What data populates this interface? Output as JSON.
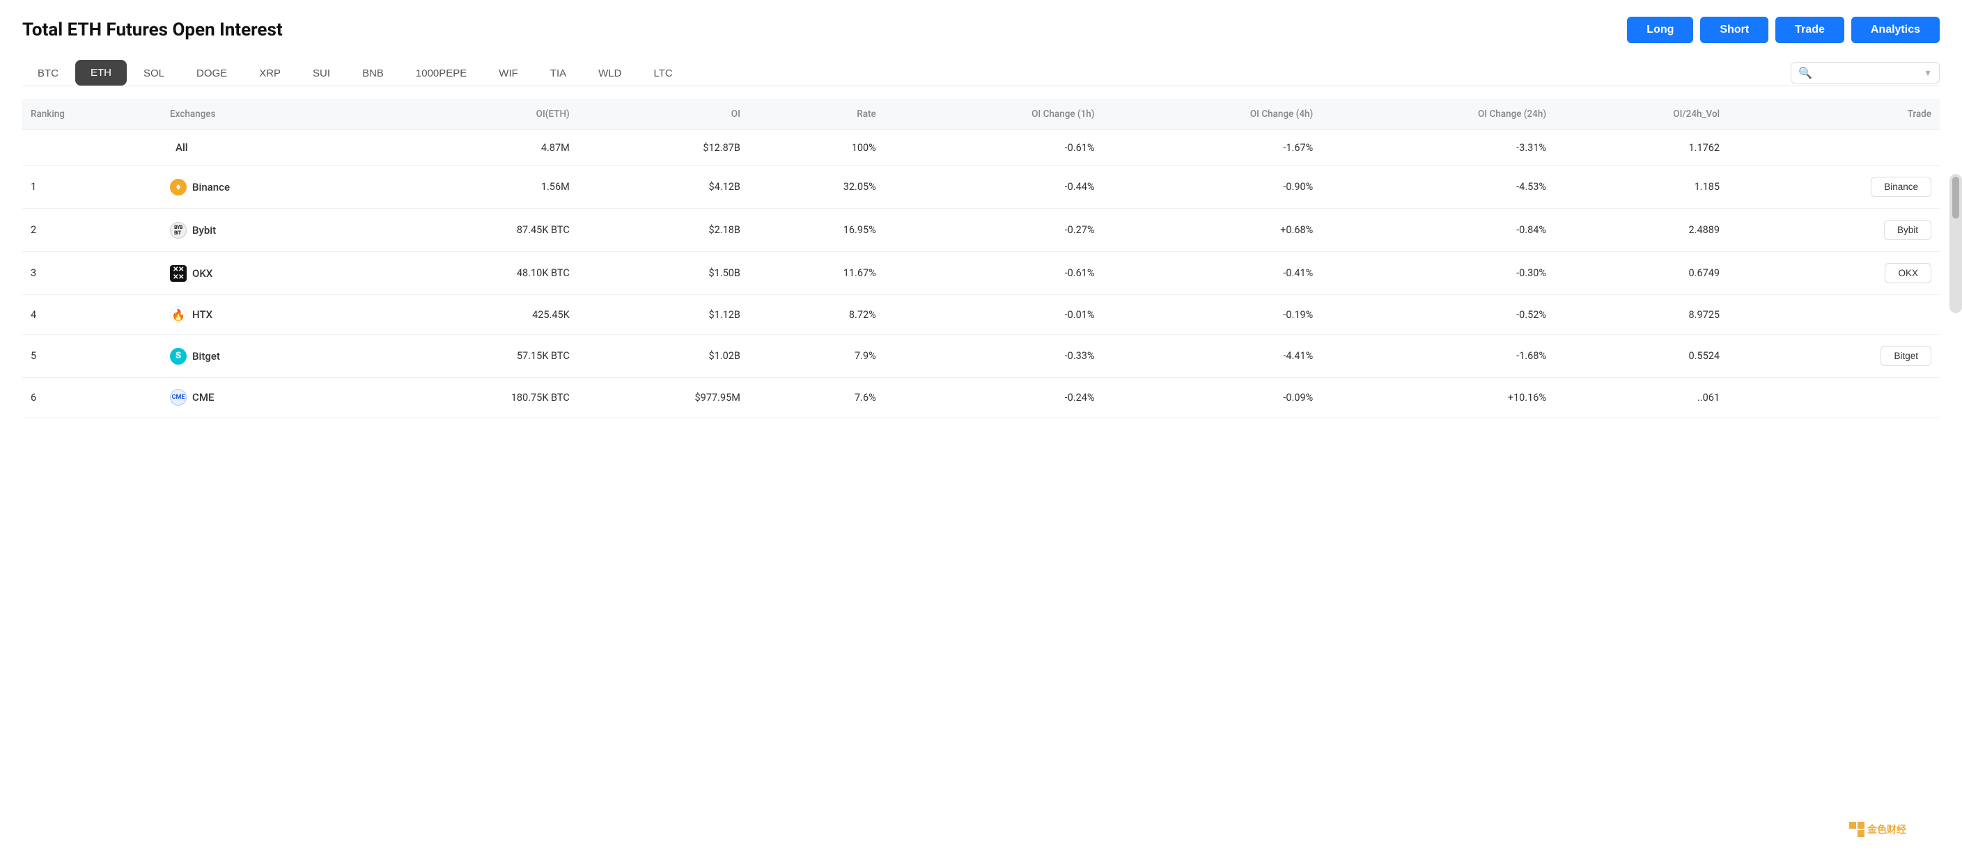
{
  "page": {
    "title": "Total ETH Futures Open Interest"
  },
  "header_buttons": [
    {
      "label": "Long",
      "key": "long"
    },
    {
      "label": "Short",
      "key": "short"
    },
    {
      "label": "Trade",
      "key": "trade"
    },
    {
      "label": "Analytics",
      "key": "analytics"
    }
  ],
  "asset_tabs": [
    {
      "label": "BTC",
      "active": false
    },
    {
      "label": "ETH",
      "active": true
    },
    {
      "label": "SOL",
      "active": false
    },
    {
      "label": "DOGE",
      "active": false
    },
    {
      "label": "XRP",
      "active": false
    },
    {
      "label": "SUI",
      "active": false
    },
    {
      "label": "BNB",
      "active": false
    },
    {
      "label": "1000PEPE",
      "active": false
    },
    {
      "label": "WIF",
      "active": false
    },
    {
      "label": "TIA",
      "active": false
    },
    {
      "label": "WLD",
      "active": false
    },
    {
      "label": "LTC",
      "active": false
    }
  ],
  "search": {
    "placeholder": ""
  },
  "table": {
    "columns": [
      "Ranking",
      "Exchanges",
      "OI(ETH)",
      "OI",
      "Rate",
      "OI Change (1h)",
      "OI Change (4h)",
      "OI Change (24h)",
      "OI/24h_Vol",
      "Trade"
    ],
    "rows": [
      {
        "ranking": "",
        "exchange": "All",
        "exchange_icon": "all",
        "oi_eth": "4.87M",
        "oi": "$12.87B",
        "rate": "100%",
        "oi_1h": "-0.61%",
        "oi_1h_color": "red",
        "oi_4h": "-1.67%",
        "oi_4h_color": "red",
        "oi_24h": "-3.31%",
        "oi_24h_color": "red",
        "oi_vol": "1.1762",
        "trade_btn": ""
      },
      {
        "ranking": "1",
        "exchange": "Binance",
        "exchange_icon": "binance",
        "oi_eth": "1.56M",
        "oi": "$4.12B",
        "rate": "32.05%",
        "oi_1h": "-0.44%",
        "oi_1h_color": "red",
        "oi_4h": "-0.90%",
        "oi_4h_color": "red",
        "oi_24h": "-4.53%",
        "oi_24h_color": "red",
        "oi_vol": "1.185",
        "trade_btn": "Binance"
      },
      {
        "ranking": "2",
        "exchange": "Bybit",
        "exchange_icon": "bybit",
        "oi_eth": "87.45K BTC",
        "oi": "$2.18B",
        "rate": "16.95%",
        "oi_1h": "-0.27%",
        "oi_1h_color": "red",
        "oi_4h": "+0.68%",
        "oi_4h_color": "green",
        "oi_24h": "-0.84%",
        "oi_24h_color": "red",
        "oi_vol": "2.4889",
        "trade_btn": "Bybit"
      },
      {
        "ranking": "3",
        "exchange": "OKX",
        "exchange_icon": "okx",
        "oi_eth": "48.10K BTC",
        "oi": "$1.50B",
        "rate": "11.67%",
        "oi_1h": "-0.61%",
        "oi_1h_color": "red",
        "oi_4h": "-0.41%",
        "oi_4h_color": "red",
        "oi_24h": "-0.30%",
        "oi_24h_color": "red",
        "oi_vol": "0.6749",
        "trade_btn": "OKX"
      },
      {
        "ranking": "4",
        "exchange": "HTX",
        "exchange_icon": "htx",
        "oi_eth": "425.45K",
        "oi": "$1.12B",
        "rate": "8.72%",
        "oi_1h": "-0.01%",
        "oi_1h_color": "red",
        "oi_4h": "-0.19%",
        "oi_4h_color": "red",
        "oi_24h": "-0.52%",
        "oi_24h_color": "red",
        "oi_vol": "8.9725",
        "trade_btn": ""
      },
      {
        "ranking": "5",
        "exchange": "Bitget",
        "exchange_icon": "bitget",
        "oi_eth": "57.15K BTC",
        "oi": "$1.02B",
        "rate": "7.9%",
        "oi_1h": "-0.33%",
        "oi_1h_color": "red",
        "oi_4h": "-4.41%",
        "oi_4h_color": "red",
        "oi_24h": "-1.68%",
        "oi_24h_color": "red",
        "oi_vol": "0.5524",
        "trade_btn": "Bitget"
      },
      {
        "ranking": "6",
        "exchange": "CME",
        "exchange_icon": "cme",
        "oi_eth": "180.75K BTC",
        "oi": "$977.95M",
        "rate": "7.6%",
        "oi_1h": "-0.24%",
        "oi_1h_color": "red",
        "oi_4h": "-0.09%",
        "oi_4h_color": "red",
        "oi_24h": "+10.16%",
        "oi_24h_color": "green",
        "oi_vol": "..061",
        "trade_btn": ""
      }
    ]
  }
}
